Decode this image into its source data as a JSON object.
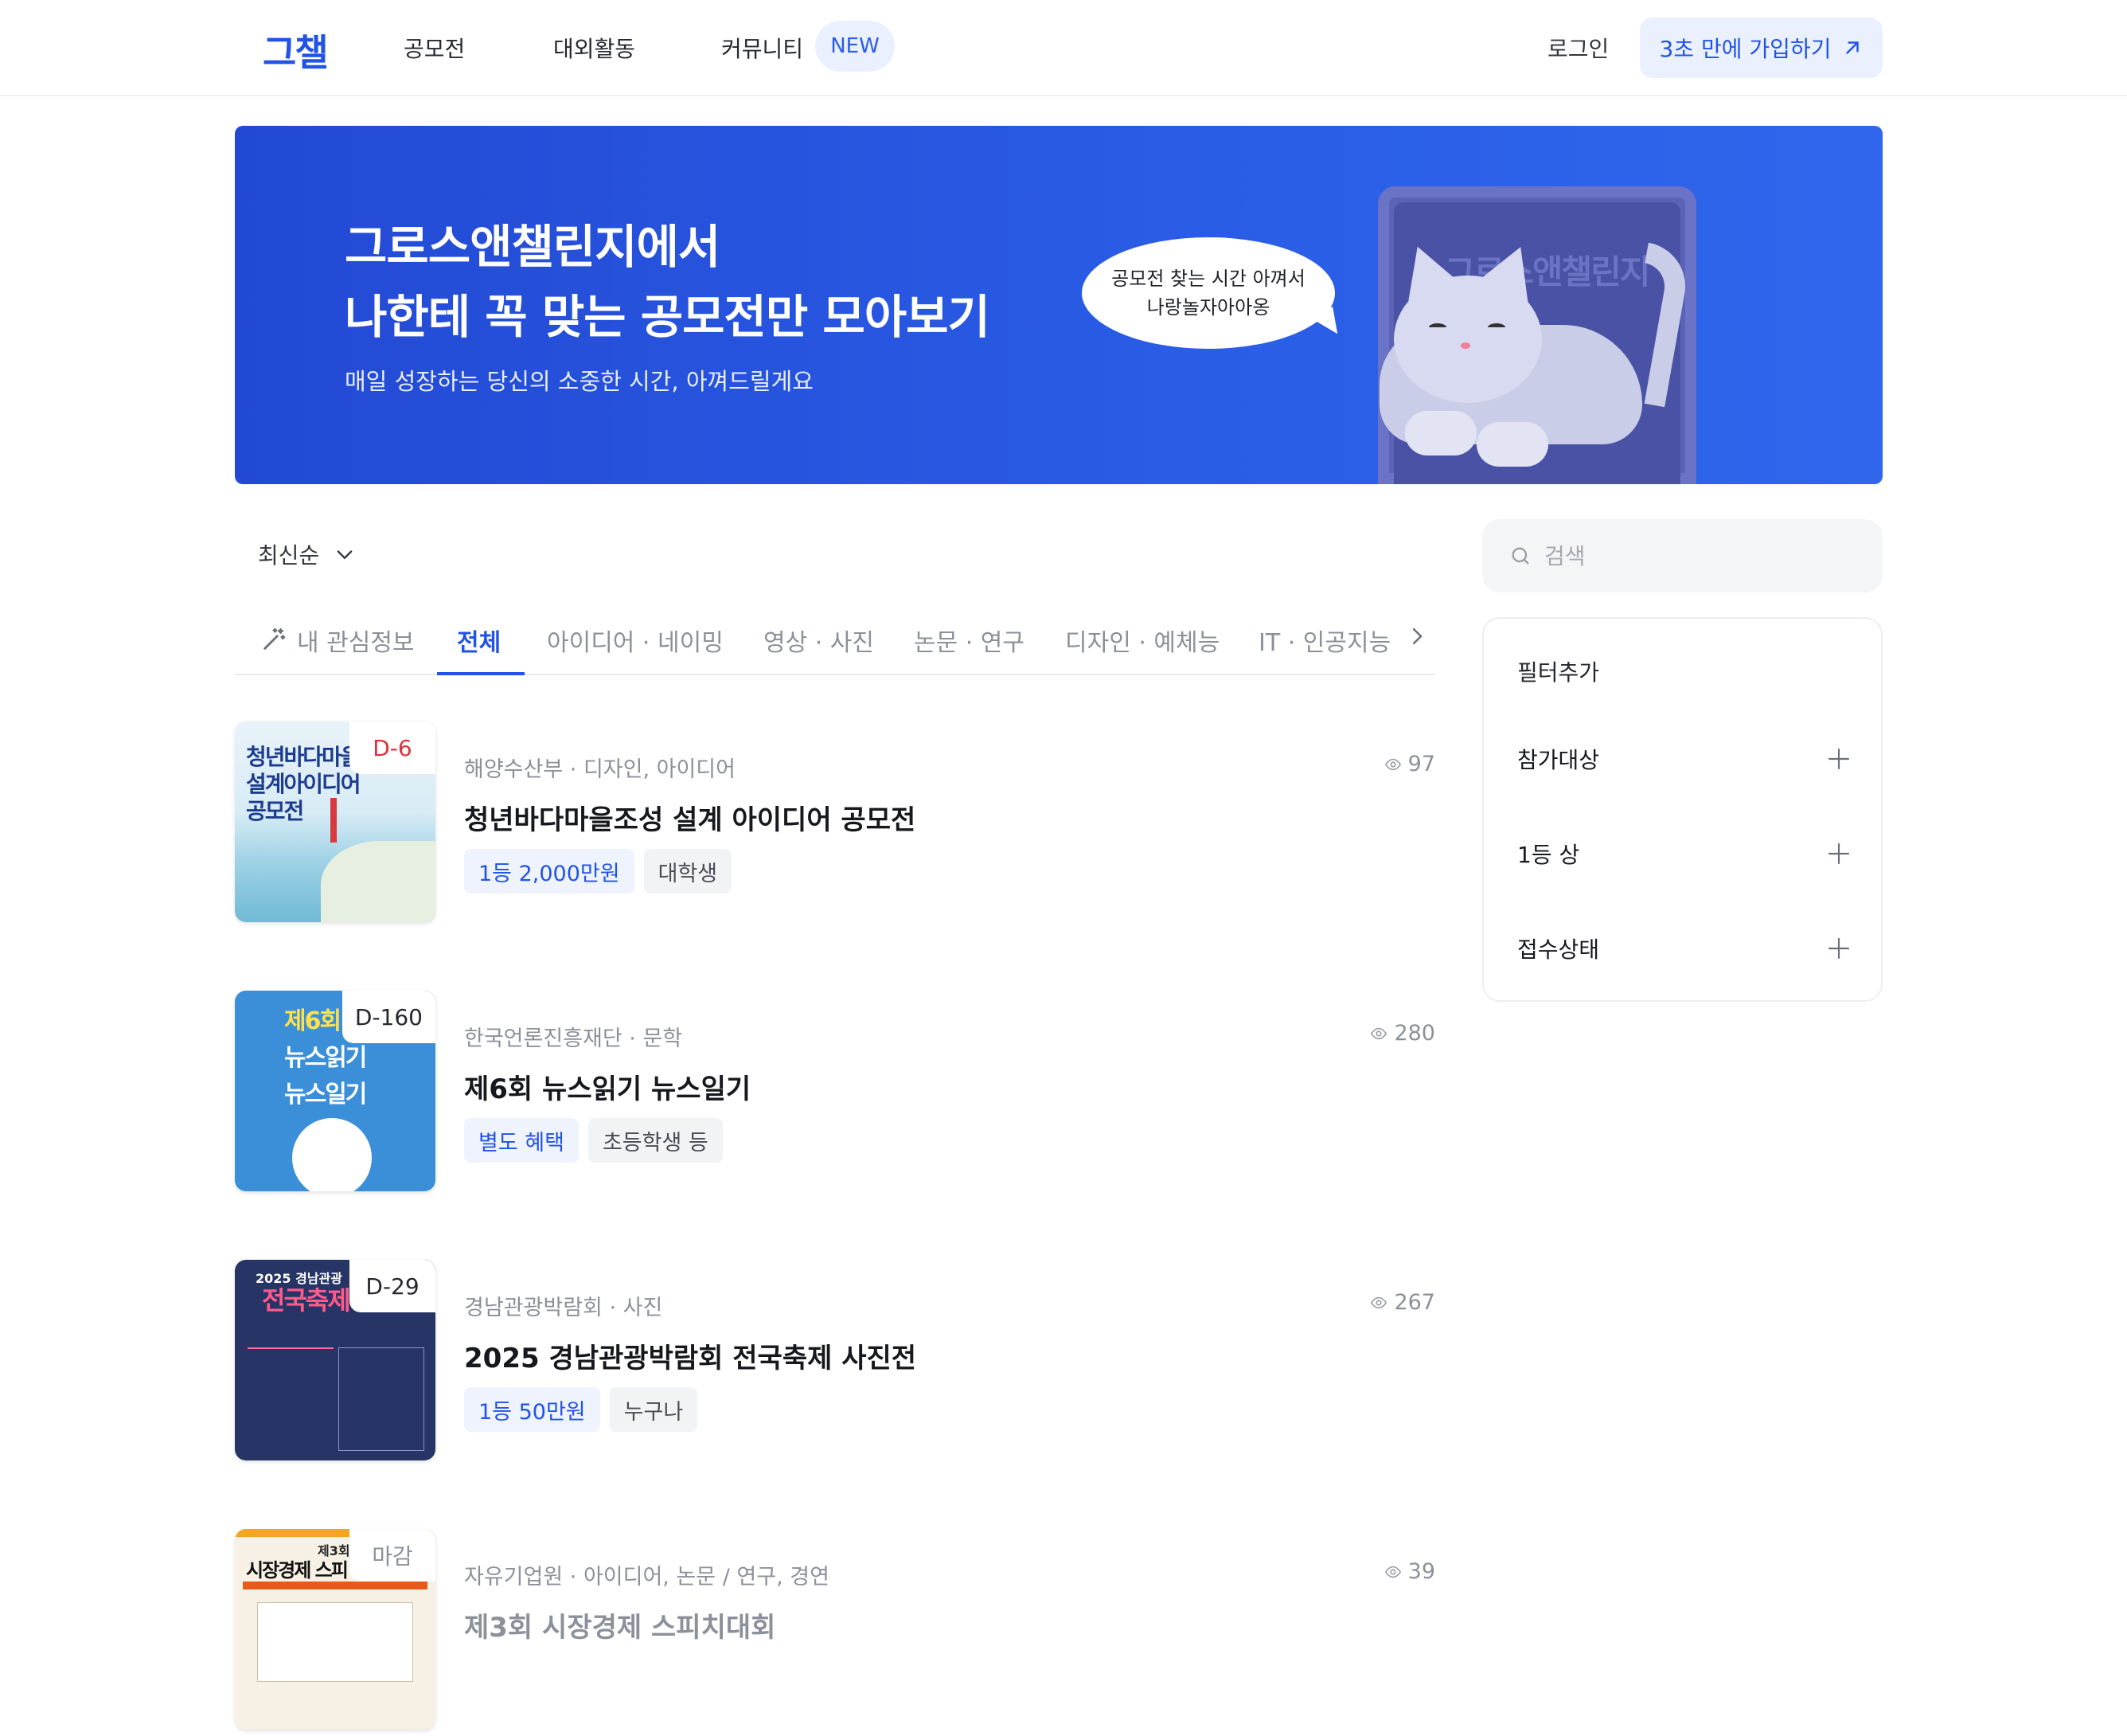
{
  "header": {
    "logo": "그챌",
    "nav": [
      "공모전",
      "대외활동",
      "커뮤니티"
    ],
    "new_badge": "NEW",
    "login": "로그인",
    "signup": "3초 만에 가입하기"
  },
  "banner": {
    "title_line1": "그로스앤챌린지에서",
    "title_line2": "나한테 꼭 맞는 공모전만 모아보기",
    "subtitle": "매일 성장하는 당신의 소중한 시간, 아껴드릴게요",
    "bubble_line1": "공모전 찾는 시간 아껴서",
    "bubble_line2": "나랑놀자아아옹",
    "monitor_text": "그로스앤챌린지"
  },
  "sort": {
    "label": "최신순"
  },
  "tabs": [
    "내 관심정보",
    "전체",
    "아이디어 · 네이밍",
    "영상 · 사진",
    "논문 · 연구",
    "디자인 · 예체능",
    "IT · 인공지능"
  ],
  "search": {
    "placeholder": "검색"
  },
  "filters": {
    "title": "필터추가",
    "items": [
      "참가대상",
      "1등 상",
      "접수상태"
    ]
  },
  "contests": [
    {
      "dday": "D-6",
      "meta": "해양수산부 · 디자인, 아이디어",
      "views": "97",
      "title": "청년바다마을조성 설계 아이디어 공모전",
      "prize": "1등 2,000만원",
      "target": "대학생",
      "thumb_text": [
        "청년바다마을",
        "설계아이디어",
        "공모전"
      ]
    },
    {
      "dday": "D-160",
      "meta": "한국언론진흥재단 · 문학",
      "views": "280",
      "title": "제6회 뉴스읽기 뉴스일기",
      "prize": "별도 혜택",
      "target": "초등학생 등",
      "thumb_text": [
        "제6회",
        "뉴스읽기",
        "뉴스일기"
      ]
    },
    {
      "dday": "D-29",
      "meta": "경남관광박람회 · 사진",
      "views": "267",
      "title": "2025 경남관광박람회 전국축제 사진전",
      "prize": "1등 50만원",
      "target": "누구나",
      "thumb_text": [
        "2025 경남관광",
        "전국축제"
      ]
    },
    {
      "dday": "마감",
      "meta": "자유기업원 · 아이디어, 논문 / 연구, 경연",
      "views": "39",
      "title": "제3회 시장경제 스피치대회",
      "thumb_text": [
        "제3회",
        "시장경제 스피"
      ]
    }
  ],
  "colors": {
    "accent": "#2153e6",
    "banner": "#2a5de6",
    "dday_urgent": "#e0303c"
  }
}
